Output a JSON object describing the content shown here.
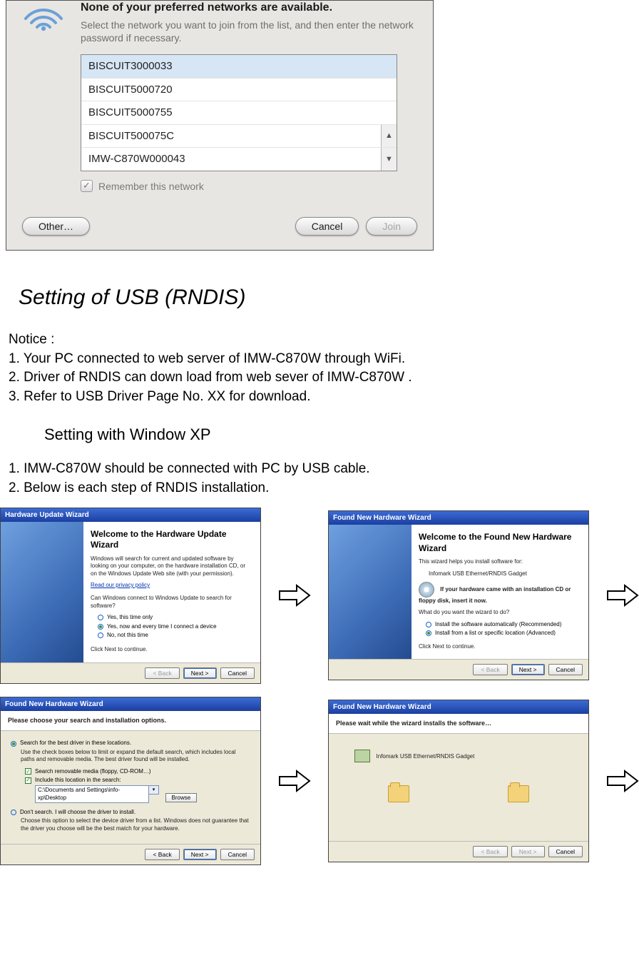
{
  "airport": {
    "title": "None of your preferred networks are available.",
    "subtitle": "Select the network you want to join from the list, and then enter the network password if necessary.",
    "networks": [
      "BISCUIT3000033",
      "BISCUIT5000720",
      "BISCUIT5000755",
      "BISCUIT500075C",
      "IMW-C870W000043"
    ],
    "remember_label": "Remember this network",
    "buttons": {
      "other": "Other…",
      "cancel": "Cancel",
      "join": "Join"
    }
  },
  "section_title": "Setting  of  USB  (RNDIS)",
  "notice_label": "Notice :",
  "notice_items": [
    "1. Your PC connected to web server of IMW-C870W    through WiFi.",
    "2. Driver of RNDIS can down load from web sever of IMW-C870W .",
    "3. Refer to USB Driver Page No. XX for download."
  ],
  "sub_title": "Setting  with  Window  XP",
  "steps_intro": [
    "1. IMW-C870W    should be connected with PC by USB cable.",
    "2. Below is each step of RNDIS installation."
  ],
  "wiz1": {
    "bar": "Hardware Update Wizard",
    "heading": "Welcome to the Hardware Update Wizard",
    "desc": "Windows will search for current and updated software by looking on your computer, on the hardware installation CD, or on the Windows Update Web site (with your permission).",
    "link": "Read our privacy policy",
    "q": "Can Windows connect to Windows Update to search for software?",
    "opt1": "Yes, this time only",
    "opt2": "Yes, now and every time I connect a device",
    "opt3": "No, not this time",
    "click_next": "Click Next to continue.",
    "back": "< Back",
    "next": "Next >",
    "cancel": "Cancel"
  },
  "wiz2": {
    "bar": "Found New Hardware Wizard",
    "heading": "Welcome to the Found New Hardware Wizard",
    "desc": "This wizard helps you install software for:",
    "device": "Infomark USB Ethernet/RNDIS Gadget",
    "cd_hint": "If your hardware came with an installation CD or floppy disk, insert it now.",
    "q": "What do you want the wizard to do?",
    "opt1": "Install the software automatically (Recommended)",
    "opt2": "Install from a list or specific location (Advanced)",
    "click_next": "Click Next to continue.",
    "back": "< Back",
    "next": "Next >",
    "cancel": "Cancel"
  },
  "wiz3": {
    "bar": "Found New Hardware Wizard",
    "heading": "Please choose your search and installation options.",
    "opt_search": "Search for the best driver in these locations.",
    "opt_search_desc": "Use the check boxes below to limit or expand the default search, which includes local paths and removable media. The best driver found will be installed.",
    "chk1": "Search removable media (floppy, CD-ROM…)",
    "chk2": "Include this location in the search:",
    "path": "C:\\Documents and Settings\\info-xp\\Desktop",
    "browse": "Browse",
    "opt_dont": "Don't search. I will choose the driver to install.",
    "opt_dont_desc": "Choose this option to select the device driver from a list. Windows does not guarantee that the driver you choose will be the best match for your hardware.",
    "back": "< Back",
    "next": "Next >",
    "cancel": "Cancel"
  },
  "wiz4": {
    "bar": "Found New Hardware Wizard",
    "heading": "Please wait while the wizard installs the software…",
    "device": "Infomark USB Ethernet/RNDIS Gadget",
    "back": "< Back",
    "next": "Next >",
    "cancel": "Cancel"
  }
}
